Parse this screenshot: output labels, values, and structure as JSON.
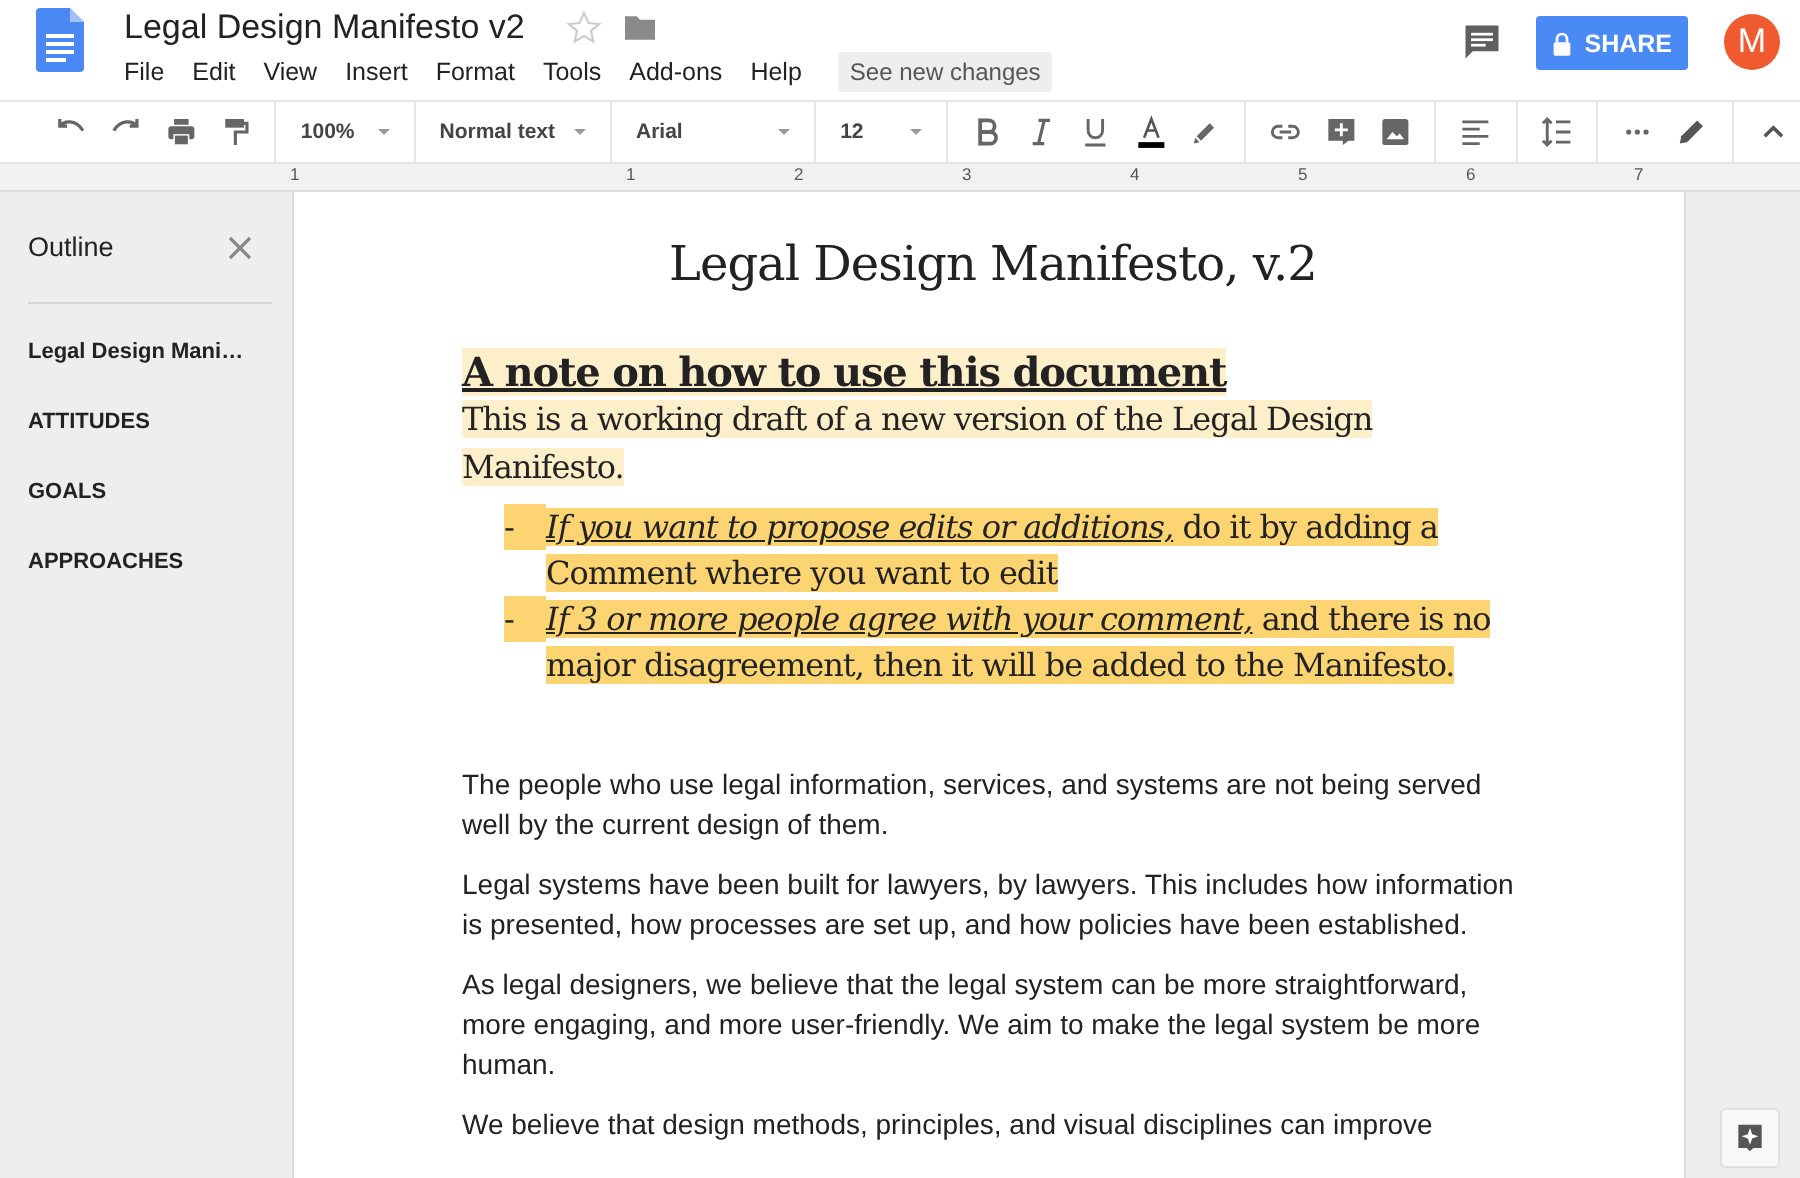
{
  "document": {
    "title": "Legal Design Manifesto v2",
    "menus": [
      "File",
      "Edit",
      "View",
      "Insert",
      "Format",
      "Tools",
      "Add-ons",
      "Help"
    ],
    "changes_button": "See new changes"
  },
  "header": {
    "share": "SHARE",
    "avatar": "M"
  },
  "toolbar": {
    "zoom": "100%",
    "style": "Normal text",
    "font": "Arial",
    "size": "12"
  },
  "ruler": [
    "1",
    "1",
    "2",
    "3",
    "4",
    "5",
    "6",
    "7"
  ],
  "outline": {
    "title": "Outline",
    "items": [
      "Legal Design Mani…",
      "ATTITUDES",
      "GOALS",
      "APPROACHES"
    ]
  },
  "page": {
    "title": "Legal Design Manifesto, v.2",
    "heading": "A note on how to use this document",
    "intro": "This is a working draft of a new version of the Legal Design Manifesto.",
    "bullets": [
      {
        "marker": "-",
        "lead": "If you want to propose edits or additions,",
        "rest": " do it by adding a Comment where you want to edit"
      },
      {
        "marker": "-",
        "lead": "If 3 or more people agree with your comment,",
        "rest": " and there is no major disagreement, then it will be added to the Manifesto."
      }
    ],
    "paragraphs": [
      "The people who use legal information, services, and systems are not being served well by the current design of them.",
      "Legal systems have been built for lawyers, by lawyers. This includes how information is presented, how processes are set up, and how policies have been established.",
      "As legal designers, we believe that the legal system can be more straightforward, more engaging, and more user-friendly. We aim to make the legal system be more human.",
      "We believe that design methods, principles, and visual disciplines can improve"
    ]
  }
}
